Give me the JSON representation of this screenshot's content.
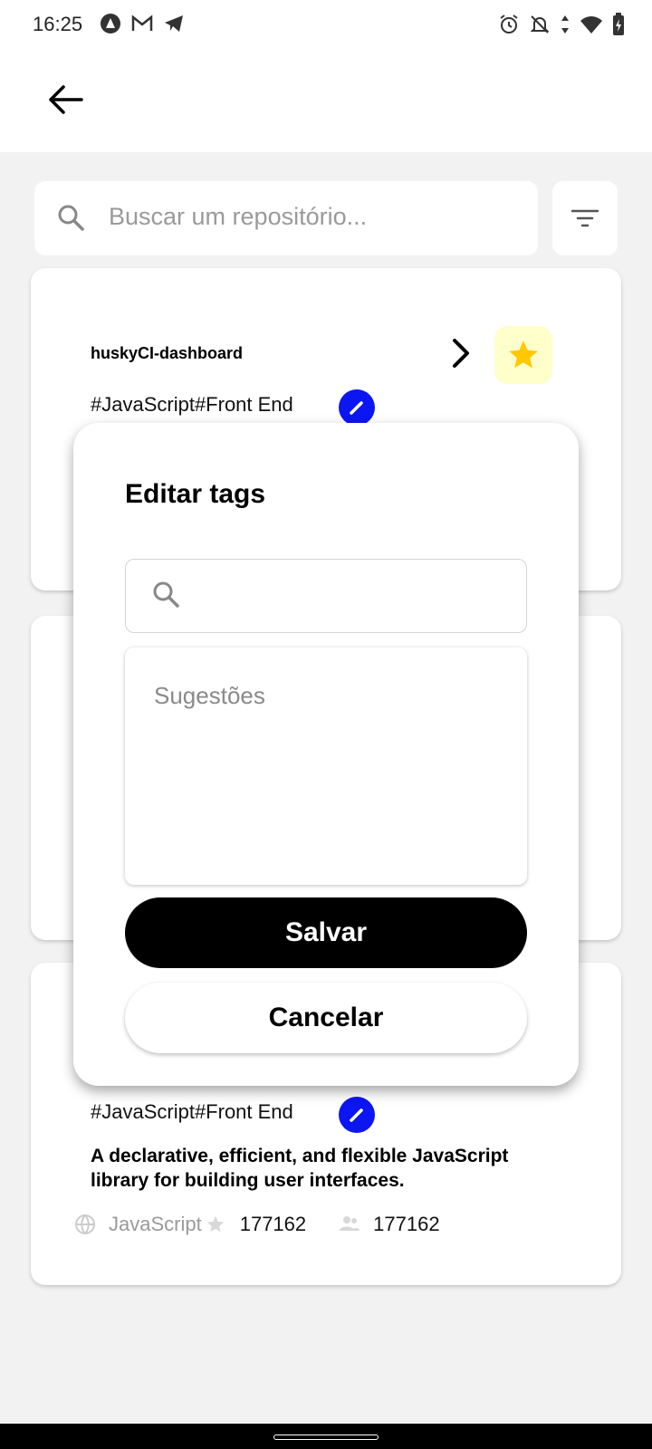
{
  "status_bar": {
    "time": "16:25"
  },
  "search": {
    "placeholder": "Buscar um repositório..."
  },
  "repo_card_1": {
    "name": "huskyCI-dashboard",
    "tags": "#JavaScript#Front End"
  },
  "repo_card_3": {
    "tags": "#JavaScript#Front End",
    "description": "A declarative, efficient, and flexible JavaScript library for building user interfaces.",
    "language": "JavaScript",
    "stars": "177162",
    "forks": "177162"
  },
  "dialog": {
    "title": "Editar tags",
    "suggestions_label": "Sugestões",
    "save_label": "Salvar",
    "cancel_label": "Cancelar"
  },
  "colors": {
    "accent_edit": "#0b16f2",
    "star": "#ffc800",
    "star_bg": "#ffffcc"
  }
}
